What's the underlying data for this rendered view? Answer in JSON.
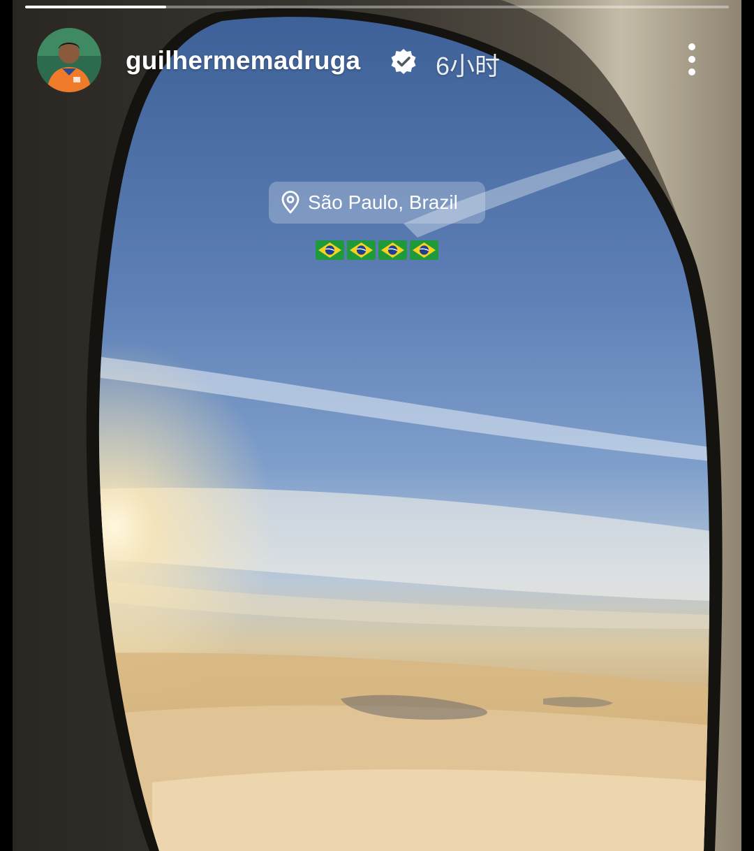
{
  "story": {
    "progress_fraction": 0.2,
    "username": "guilhermemadruga",
    "verified": true,
    "timestamp": "6小时",
    "location_label": "São Paulo, Brazil",
    "emoji_text": "🇧🇷🇧🇷🇧🇷🇧🇷",
    "flag_count": 4
  },
  "icons": {
    "verified": "verified-badge-icon",
    "more": "more-vertical-icon",
    "location": "location-pin-icon",
    "flag": "brazil-flag-icon"
  },
  "colors": {
    "verified_badge": "#ffffff",
    "flag_green": "#1f9a3a",
    "flag_yellow": "#f7d21e",
    "flag_blue": "#1e3f8f"
  }
}
